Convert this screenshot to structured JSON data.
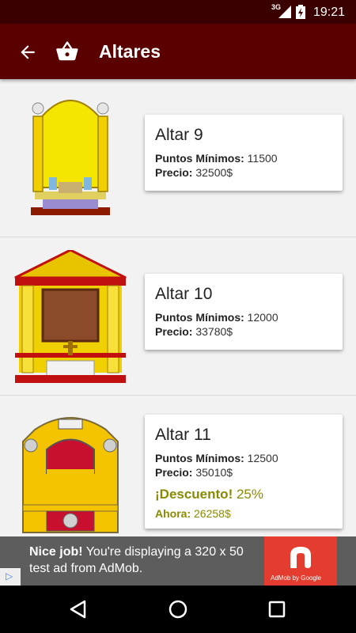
{
  "status_bar": {
    "network": "3G",
    "time": "19:21"
  },
  "app_bar": {
    "title": "Altares",
    "back_icon": "arrow-back-icon",
    "cart_icon": "basket-icon"
  },
  "items": [
    {
      "name": "Altar 9",
      "points_label": "Puntos Mínimos:",
      "points_value": "11500",
      "price_label": "Precio:",
      "price_value": "32500$"
    },
    {
      "name": "Altar 10",
      "points_label": "Puntos Mínimos:",
      "points_value": "12000",
      "price_label": "Precio:",
      "price_value": "33780$"
    },
    {
      "name": "Altar 11",
      "points_label": "Puntos Mínimos:",
      "points_value": "12500",
      "price_label": "Precio:",
      "price_value": "35010$",
      "discount_label": "¡Descuento!",
      "discount_value": "25%",
      "now_label": "Ahora:",
      "now_value": "26258$"
    }
  ],
  "ad": {
    "headline": "Nice job!",
    "body": "You're displaying a 320 x 50 test ad from AdMob.",
    "brand": "AdMob by Google"
  },
  "colors": {
    "status_bar": "#3a0000",
    "app_bar": "#5b0000",
    "discount": "#8a8a00",
    "admob": "#e43c2f"
  }
}
